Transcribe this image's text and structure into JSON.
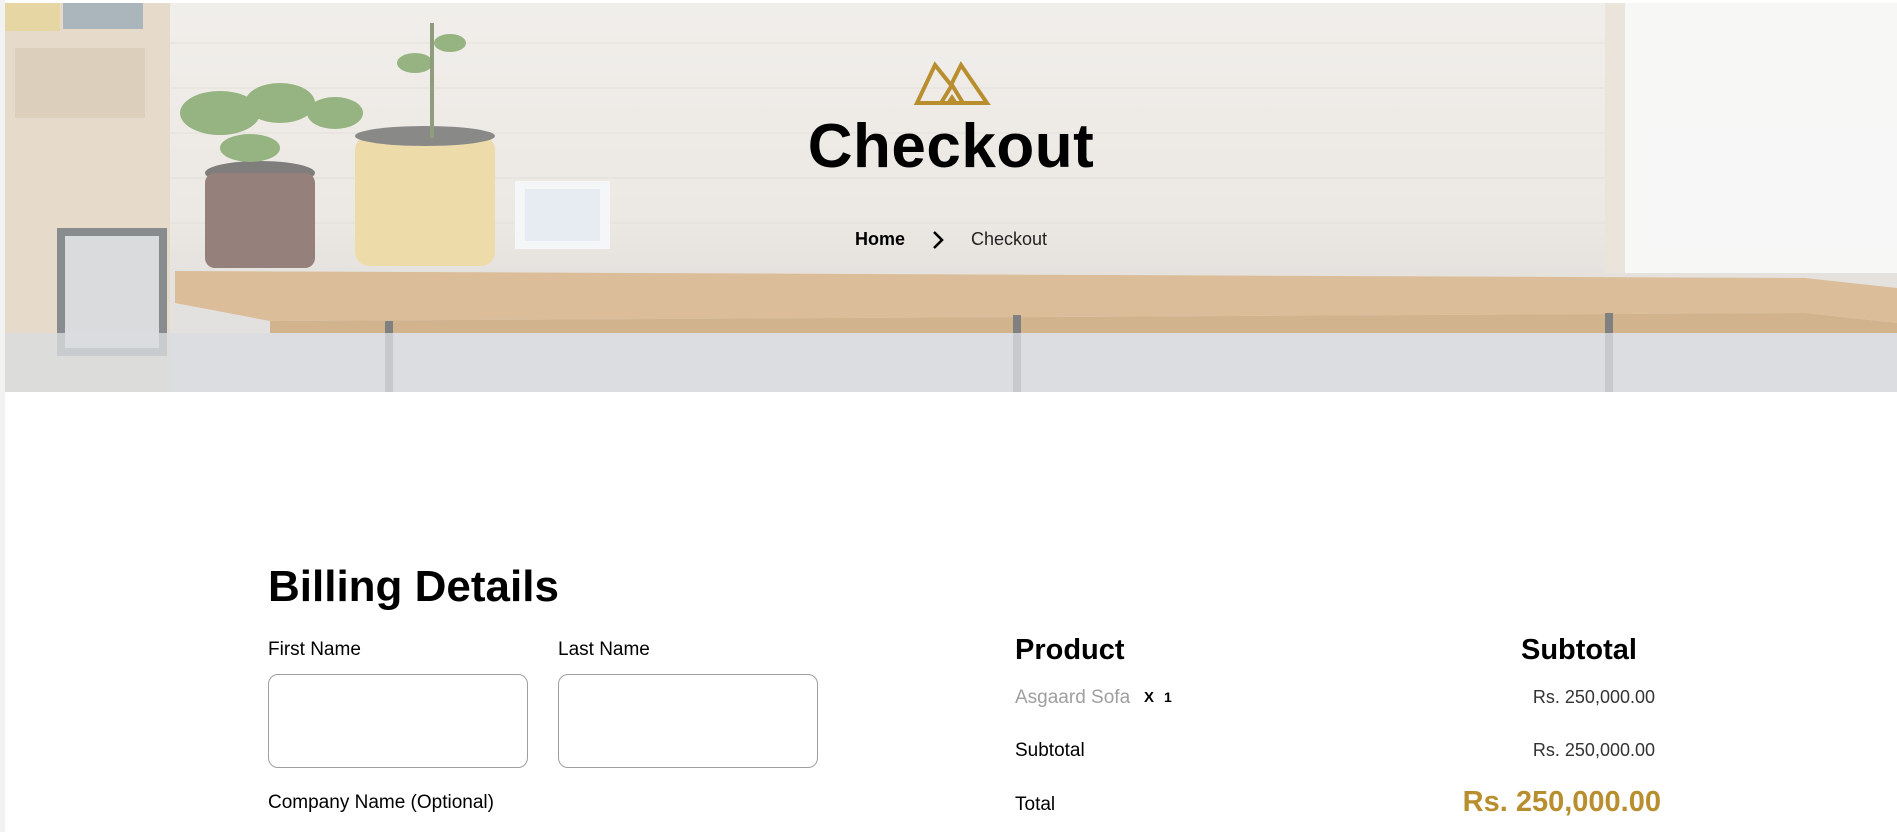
{
  "colors": {
    "accent": "#b88e2f",
    "muted_text": "#9f9f9f",
    "input_border": "#9f9f9f"
  },
  "hero": {
    "logo_icon": "brand-logo-icon",
    "title": "Checkout",
    "breadcrumb": {
      "home": "Home",
      "separator_icon": "chevron-right-icon",
      "current": "Checkout"
    }
  },
  "billing": {
    "title": "Billing Details",
    "first_name_label": "First Name",
    "first_name_value": "",
    "last_name_label": "Last Name",
    "last_name_value": "",
    "company_label": "Company Name (Optional)"
  },
  "order_summary": {
    "product_header": "Product",
    "subtotal_header": "Subtotal",
    "items": [
      {
        "name": "Asgaard Sofa",
        "times": "X",
        "qty": "1",
        "price": "Rs. 250,000.00"
      }
    ],
    "subtotal_label": "Subtotal",
    "subtotal_value": "Rs. 250,000.00",
    "total_label": "Total",
    "total_value": "Rs. 250,000.00"
  }
}
